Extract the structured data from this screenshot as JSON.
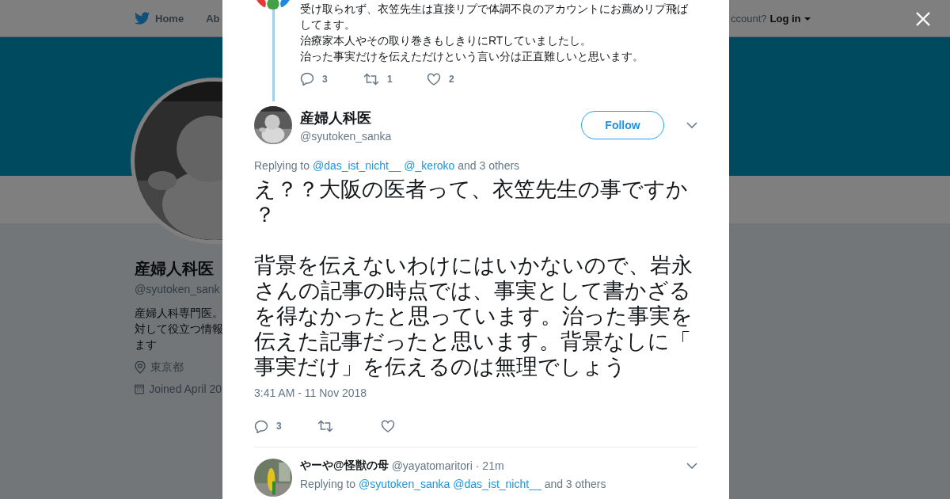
{
  "page": {
    "nav": {
      "items": [
        {
          "label": "Home",
          "kind": "bird"
        },
        {
          "label": "Ab",
          "kind": "plain"
        }
      ],
      "login_prompt": "ccount?",
      "login": "Log in"
    },
    "profile": {
      "name": "産婦人科医",
      "handle": "@syutoken_sank",
      "bio": [
        "産婦人科専門医。",
        "対して役立つ情報",
        "ます"
      ],
      "location": "東京都",
      "joined": "Joined April 20"
    }
  },
  "modal": {
    "thread_tweet": {
      "paragraphs": [
        "受け取られず、衣笠先生は直接リプで体調不良のアカウントにお薦めリプ飛ばしてます。",
        "治療家本人やその取り巻きもしきりにRTしていましたし。",
        "治った事実だけを伝えただけという言い分は正直難しいと思います。"
      ],
      "actions": [
        {
          "kind": "reply",
          "count": "3"
        },
        {
          "kind": "retweet",
          "count": "1"
        },
        {
          "kind": "like",
          "count": "2"
        }
      ]
    },
    "focused_tweet": {
      "name": "産婦人科医",
      "handle": "@syutoken_sanka",
      "follow": "Follow",
      "replying_prefix": "Replying to",
      "replying_to": [
        "@das_ist_nicht__",
        "@_keroko"
      ],
      "replying_suffix": "and 3 others",
      "paragraphs": [
        "え？？大阪の医者って、衣笠先生の事ですか？",
        "背景を伝えないわけにはいかないので、岩永さんの記事の時点では、事実として書かざるを得なかったと思っています。治った事実を伝えた記事だったと思います。背景なしに「事実だけ」を伝えるのは無理でしょう"
      ],
      "timestamp": "3:41 AM - 11 Nov 2018",
      "actions": [
        {
          "kind": "reply",
          "count": "3"
        },
        {
          "kind": "retweet"
        },
        {
          "kind": "like"
        }
      ]
    },
    "reply_tweet": {
      "name": "やーや@怪獣の母",
      "handle": "@yayatomaritori",
      "time": "· 21m",
      "replying_prefix": "Replying to",
      "replying_to": [
        "@syutoken_sanka",
        "@das_ist_nicht__"
      ],
      "replying_suffix": "and 3 others"
    }
  }
}
